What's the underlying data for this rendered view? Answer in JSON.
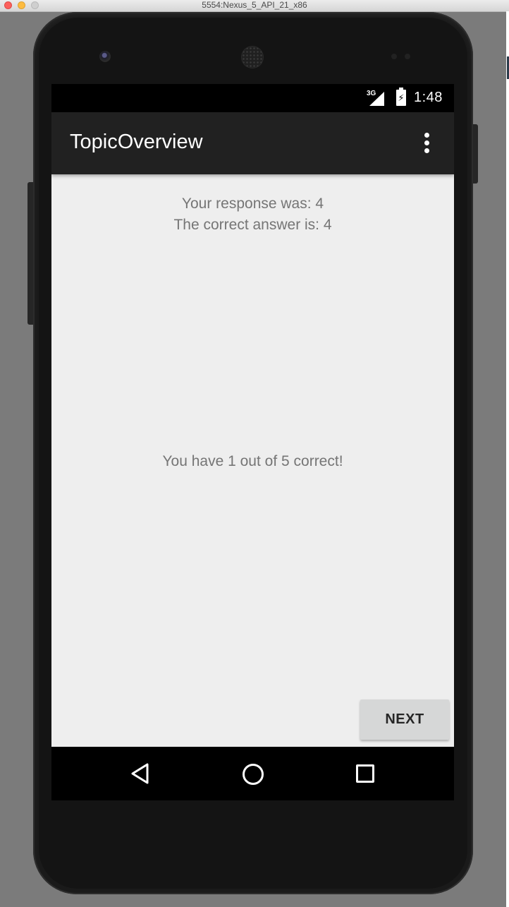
{
  "window": {
    "title": "5554:Nexus_5_API_21_x86"
  },
  "status_bar": {
    "network": "3G",
    "time": "1:48"
  },
  "app_bar": {
    "title": "TopicOverview"
  },
  "content": {
    "response_text": "Your response was: 4",
    "answer_text": "The correct answer is: 4",
    "score_text": "You have 1 out of 5 correct!"
  },
  "actions": {
    "next_label": "NEXT"
  },
  "icons": {
    "overflow": "more-vert-icon",
    "back": "back-triangle-icon",
    "home": "home-circle-icon",
    "recents": "recents-square-icon"
  },
  "colors": {
    "app_bar": "#212121",
    "screen_background": "#eeeeee",
    "body_text": "#757575",
    "button_background": "#d6d7d7"
  }
}
